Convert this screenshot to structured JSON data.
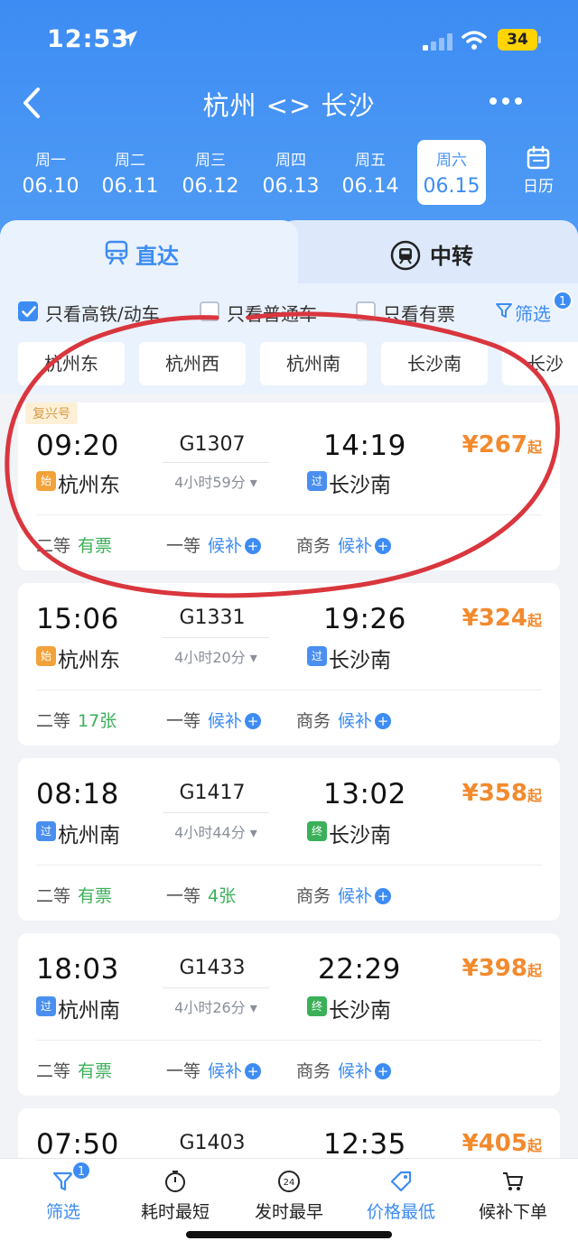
{
  "status_bar": {
    "time": "12:53",
    "battery": "34"
  },
  "nav": {
    "title": "杭州 <> 长沙"
  },
  "dates": [
    {
      "weekday": "周一",
      "date": "06.10"
    },
    {
      "weekday": "周二",
      "date": "06.11"
    },
    {
      "weekday": "周三",
      "date": "06.12"
    },
    {
      "weekday": "周四",
      "date": "06.13"
    },
    {
      "weekday": "周五",
      "date": "06.14"
    },
    {
      "weekday": "周六",
      "date": "06.15",
      "selected": true
    }
  ],
  "calendar_label": "日历",
  "tabs": {
    "direct": "直达",
    "transfer": "中转"
  },
  "filters": {
    "high_speed": "只看高铁/动车",
    "regular": "只看普通车",
    "available": "只看有票",
    "filter_btn": "筛选",
    "filter_badge": "1"
  },
  "stations": [
    "杭州东",
    "杭州西",
    "杭州南",
    "长沙南",
    "长沙"
  ],
  "trains": [
    {
      "tag": "复兴号",
      "dep_time": "09:20",
      "train_no": "G1307",
      "arr_time": "14:19",
      "dep_tag": "始",
      "dep_station": "杭州东",
      "duration": "4小时59分",
      "arr_tag": "过",
      "arr_station": "长沙南",
      "price": "¥267",
      "price_suffix": "起",
      "seats": [
        {
          "class": "二等",
          "status": "有票"
        },
        {
          "class": "一等",
          "status": "候补"
        },
        {
          "class": "商务",
          "status": "候补"
        }
      ]
    },
    {
      "dep_time": "15:06",
      "train_no": "G1331",
      "arr_time": "19:26",
      "dep_tag": "始",
      "dep_station": "杭州东",
      "duration": "4小时20分",
      "arr_tag": "过",
      "arr_station": "长沙南",
      "price": "¥324",
      "price_suffix": "起",
      "seats": [
        {
          "class": "二等",
          "status": "17张"
        },
        {
          "class": "一等",
          "status": "候补"
        },
        {
          "class": "商务",
          "status": "候补"
        }
      ]
    },
    {
      "dep_time": "08:18",
      "train_no": "G1417",
      "arr_time": "13:02",
      "dep_tag": "过",
      "dep_station": "杭州南",
      "duration": "4小时44分",
      "arr_tag": "终",
      "arr_station": "长沙南",
      "price": "¥358",
      "price_suffix": "起",
      "seats": [
        {
          "class": "二等",
          "status": "有票"
        },
        {
          "class": "一等",
          "status": "4张"
        },
        {
          "class": "商务",
          "status": "候补"
        }
      ]
    },
    {
      "dep_time": "18:03",
      "train_no": "G1433",
      "arr_time": "22:29",
      "dep_tag": "过",
      "dep_station": "杭州南",
      "duration": "4小时26分",
      "arr_tag": "终",
      "arr_station": "长沙南",
      "price": "¥398",
      "price_suffix": "起",
      "seats": [
        {
          "class": "二等",
          "status": "有票"
        },
        {
          "class": "一等",
          "status": "候补"
        },
        {
          "class": "商务",
          "status": "候补"
        }
      ]
    },
    {
      "dep_time": "07:50",
      "train_no": "G1403",
      "arr_time": "12:35",
      "price": "¥405",
      "price_suffix": "起"
    }
  ],
  "bottom_bar": {
    "filter": "筛选",
    "filter_badge": "1",
    "shortest": "耗时最短",
    "earliest": "发时最早",
    "lowest_price": "价格最低",
    "waitlist_order": "候补下单"
  },
  "colors": {
    "primary": "#3d8cf3",
    "price": "#f28a2e",
    "available": "#3bb058",
    "tag_start": "#f2a23a",
    "tag_pass": "#4a8ff0",
    "tag_end": "#3bb058",
    "annotation": "#d9363e"
  }
}
